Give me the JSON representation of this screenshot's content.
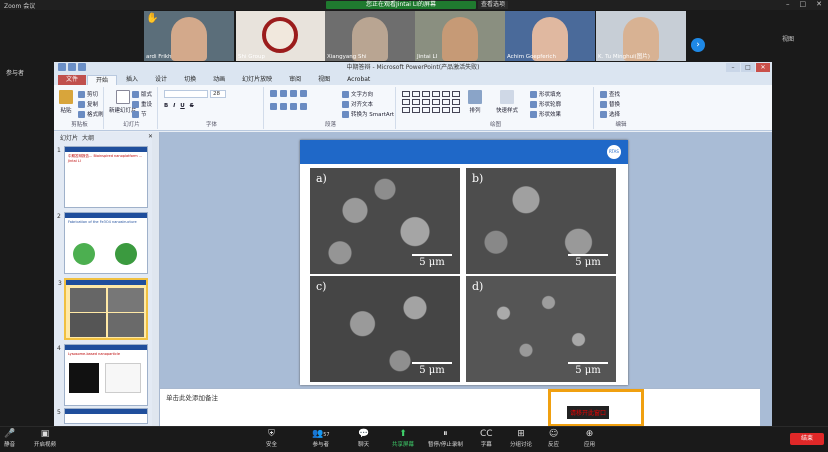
{
  "zoom": {
    "title": "Zoom 会议",
    "share_banner": "您正在观看Jintai LI的屏幕",
    "view_options": "查看选项",
    "gallery_label": "视图",
    "left_status": "参与者"
  },
  "participants": [
    {
      "name": "ardi Frikh"
    },
    {
      "name": "Shi Group"
    },
    {
      "name": "Xiangyang Shi"
    },
    {
      "name": "Jintai LI"
    },
    {
      "name": "Achim Goepferich"
    },
    {
      "name": "K. Tu Minghui(图片)"
    }
  ],
  "powerpoint": {
    "window_title": "中期答辩 - Microsoft PowerPoint(产品激活失败)",
    "tabs": [
      "文件",
      "开始",
      "插入",
      "设计",
      "切换",
      "动画",
      "幻灯片放映",
      "审阅",
      "视图",
      "Acrobat"
    ],
    "active_tab": "开始",
    "groups": {
      "clipboard": {
        "label": "剪贴板",
        "paste": "粘贴",
        "cut": "剪切",
        "copy": "复制",
        "format": "格式刷"
      },
      "slides": {
        "label": "幻灯片",
        "new": "新建幻灯片",
        "layout": "版式",
        "reset": "重设",
        "section": "节"
      },
      "font": {
        "label": "字体",
        "size": "28"
      },
      "paragraph": {
        "label": "段落",
        "direction": "文字方向",
        "align": "对齐文本",
        "smartart": "转换为 SmartArt"
      },
      "drawing": {
        "label": "绘图",
        "arrange": "排列",
        "quick_styles": "快速样式",
        "fill": "形状填充",
        "outline": "形状轮廓",
        "effects": "形状效果"
      },
      "editing": {
        "label": "编辑",
        "find": "查找",
        "replace": "替换",
        "select": "选择"
      }
    },
    "panel_tabs": [
      "幻灯片",
      "大纲"
    ],
    "thumbnails": [
      {
        "num": "1",
        "text": "中期答辩报告... Bioinspired nanoplatform ... Jintai LI"
      },
      {
        "num": "2",
        "text": "Fabrication of the Fe3O4 nanostructure"
      },
      {
        "num": "3",
        "text": ""
      },
      {
        "num": "4",
        "text": "Lysosome-based nanoparticle"
      },
      {
        "num": "5",
        "text": ""
      }
    ],
    "slide": {
      "logo_text": "RTAS",
      "panels": [
        {
          "label": "a)",
          "scale": "5 μm"
        },
        {
          "label": "b)",
          "scale": "5 μm"
        },
        {
          "label": "c)",
          "scale": "5 μm"
        },
        {
          "label": "d)",
          "scale": "5 μm"
        }
      ]
    },
    "notes_placeholder": "单击此处添加备注",
    "recording_label": "请移开此窗口"
  },
  "toolbar": [
    {
      "label": "静音",
      "icon": "mic-icon"
    },
    {
      "label": "开启视频",
      "icon": "video-icon"
    },
    {
      "label": "安全",
      "icon": "shield-icon"
    },
    {
      "label": "参与者",
      "icon": "participants-icon",
      "count": "57"
    },
    {
      "label": "聊天",
      "icon": "chat-icon"
    },
    {
      "label": "共享屏幕",
      "icon": "share-icon"
    },
    {
      "label": "暂停/停止录制",
      "icon": "record-icon"
    },
    {
      "label": "字幕",
      "icon": "cc-icon"
    },
    {
      "label": "分组讨论",
      "icon": "breakout-icon"
    },
    {
      "label": "反应",
      "icon": "reaction-icon"
    },
    {
      "label": "应用",
      "icon": "apps-icon"
    }
  ],
  "end_label": "结束"
}
